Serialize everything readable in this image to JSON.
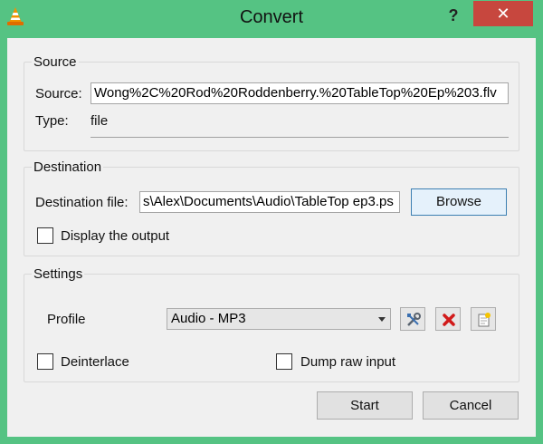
{
  "window": {
    "title": "Convert",
    "help_glyph": "?",
    "close_glyph": "✕",
    "app_icon": "vlc-cone-icon",
    "accent_color": "#55c383",
    "close_color": "#c7473e"
  },
  "source": {
    "group_title": "Source",
    "source_label": "Source:",
    "source_value": "Wong%2C%20Rod%20Roddenberry.%20TableTop%20Ep%203.flv",
    "type_label": "Type:",
    "type_value": "file"
  },
  "destination": {
    "group_title": "Destination",
    "file_label": "Destination file:",
    "file_value": "s\\Alex\\Documents\\Audio\\TableTop ep3.ps",
    "browse_label": "Browse",
    "display_output_label": "Display the output",
    "display_output_checked": false
  },
  "settings": {
    "group_title": "Settings",
    "profile_label": "Profile",
    "profile_value": "Audio - MP3",
    "edit_profile_icon": "tools-icon",
    "delete_profile_icon": "red-x-icon",
    "new_profile_icon": "new-document-icon",
    "deinterlace_label": "Deinterlace",
    "deinterlace_checked": false,
    "dump_raw_label": "Dump raw input",
    "dump_raw_checked": false
  },
  "footer": {
    "start_label": "Start",
    "cancel_label": "Cancel"
  }
}
